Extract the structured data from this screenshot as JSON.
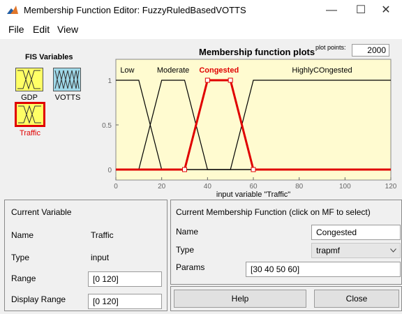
{
  "window": {
    "title": "Membership Function Editor: FuzzyRuledBasedVOTTS",
    "minimize": "—",
    "maximize": "☐",
    "close": "✕"
  },
  "menu": [
    "File",
    "Edit",
    "View"
  ],
  "fis": {
    "title": "FIS Variables",
    "vars": [
      {
        "label": "GDP",
        "kind": "input",
        "color": "#ffff66"
      },
      {
        "label": "VOTTS",
        "kind": "output",
        "color": "#9fd8e8"
      },
      {
        "label": "Traffic",
        "kind": "input",
        "color": "#ffff66",
        "selected": true
      }
    ]
  },
  "plot": {
    "title": "Membership function plots",
    "points_label": "plot points:",
    "points_value": "2000"
  },
  "chart_data": {
    "type": "line",
    "xlabel": "input variable \"Traffic\"",
    "xlim": [
      0,
      120
    ],
    "ylim": [
      0,
      1
    ],
    "xticks": [
      "0",
      "20",
      "40",
      "60",
      "80",
      "100",
      "120"
    ],
    "yticks": [
      "0",
      "0.5",
      "1"
    ],
    "background": "#fffbd0",
    "series": [
      {
        "name": "Low",
        "points": [
          [
            0,
            1
          ],
          [
            10,
            1
          ],
          [
            20,
            0
          ],
          [
            120,
            0
          ]
        ],
        "selected": false
      },
      {
        "name": "Moderate",
        "points": [
          [
            0,
            0
          ],
          [
            10,
            0
          ],
          [
            20,
            1
          ],
          [
            30,
            1
          ],
          [
            40,
            0
          ],
          [
            120,
            0
          ]
        ],
        "selected": false
      },
      {
        "name": "Congested",
        "points": [
          [
            0,
            0
          ],
          [
            30,
            0
          ],
          [
            40,
            1
          ],
          [
            50,
            1
          ],
          [
            60,
            0
          ],
          [
            120,
            0
          ]
        ],
        "selected": true
      },
      {
        "name": "HighlyCOngested",
        "points": [
          [
            0,
            0
          ],
          [
            50,
            0
          ],
          [
            60,
            1
          ],
          [
            120,
            1
          ]
        ],
        "selected": false
      }
    ],
    "colors": {
      "normal": "#000000",
      "selected": "#e00000"
    }
  },
  "current_variable": {
    "title": "Current Variable",
    "name_label": "Name",
    "name_value": "Traffic",
    "type_label": "Type",
    "type_value": "input",
    "range_label": "Range",
    "range_value": "[0 120]",
    "display_range_label": "Display Range",
    "display_range_value": "[0 120]"
  },
  "current_mf": {
    "title": "Current Membership Function (click on MF to select)",
    "name_label": "Name",
    "name_value": "Congested",
    "type_label": "Type",
    "type_value": "trapmf",
    "params_label": "Params",
    "params_value": "[30 40 50 60]"
  },
  "buttons": {
    "help": "Help",
    "close": "Close"
  }
}
